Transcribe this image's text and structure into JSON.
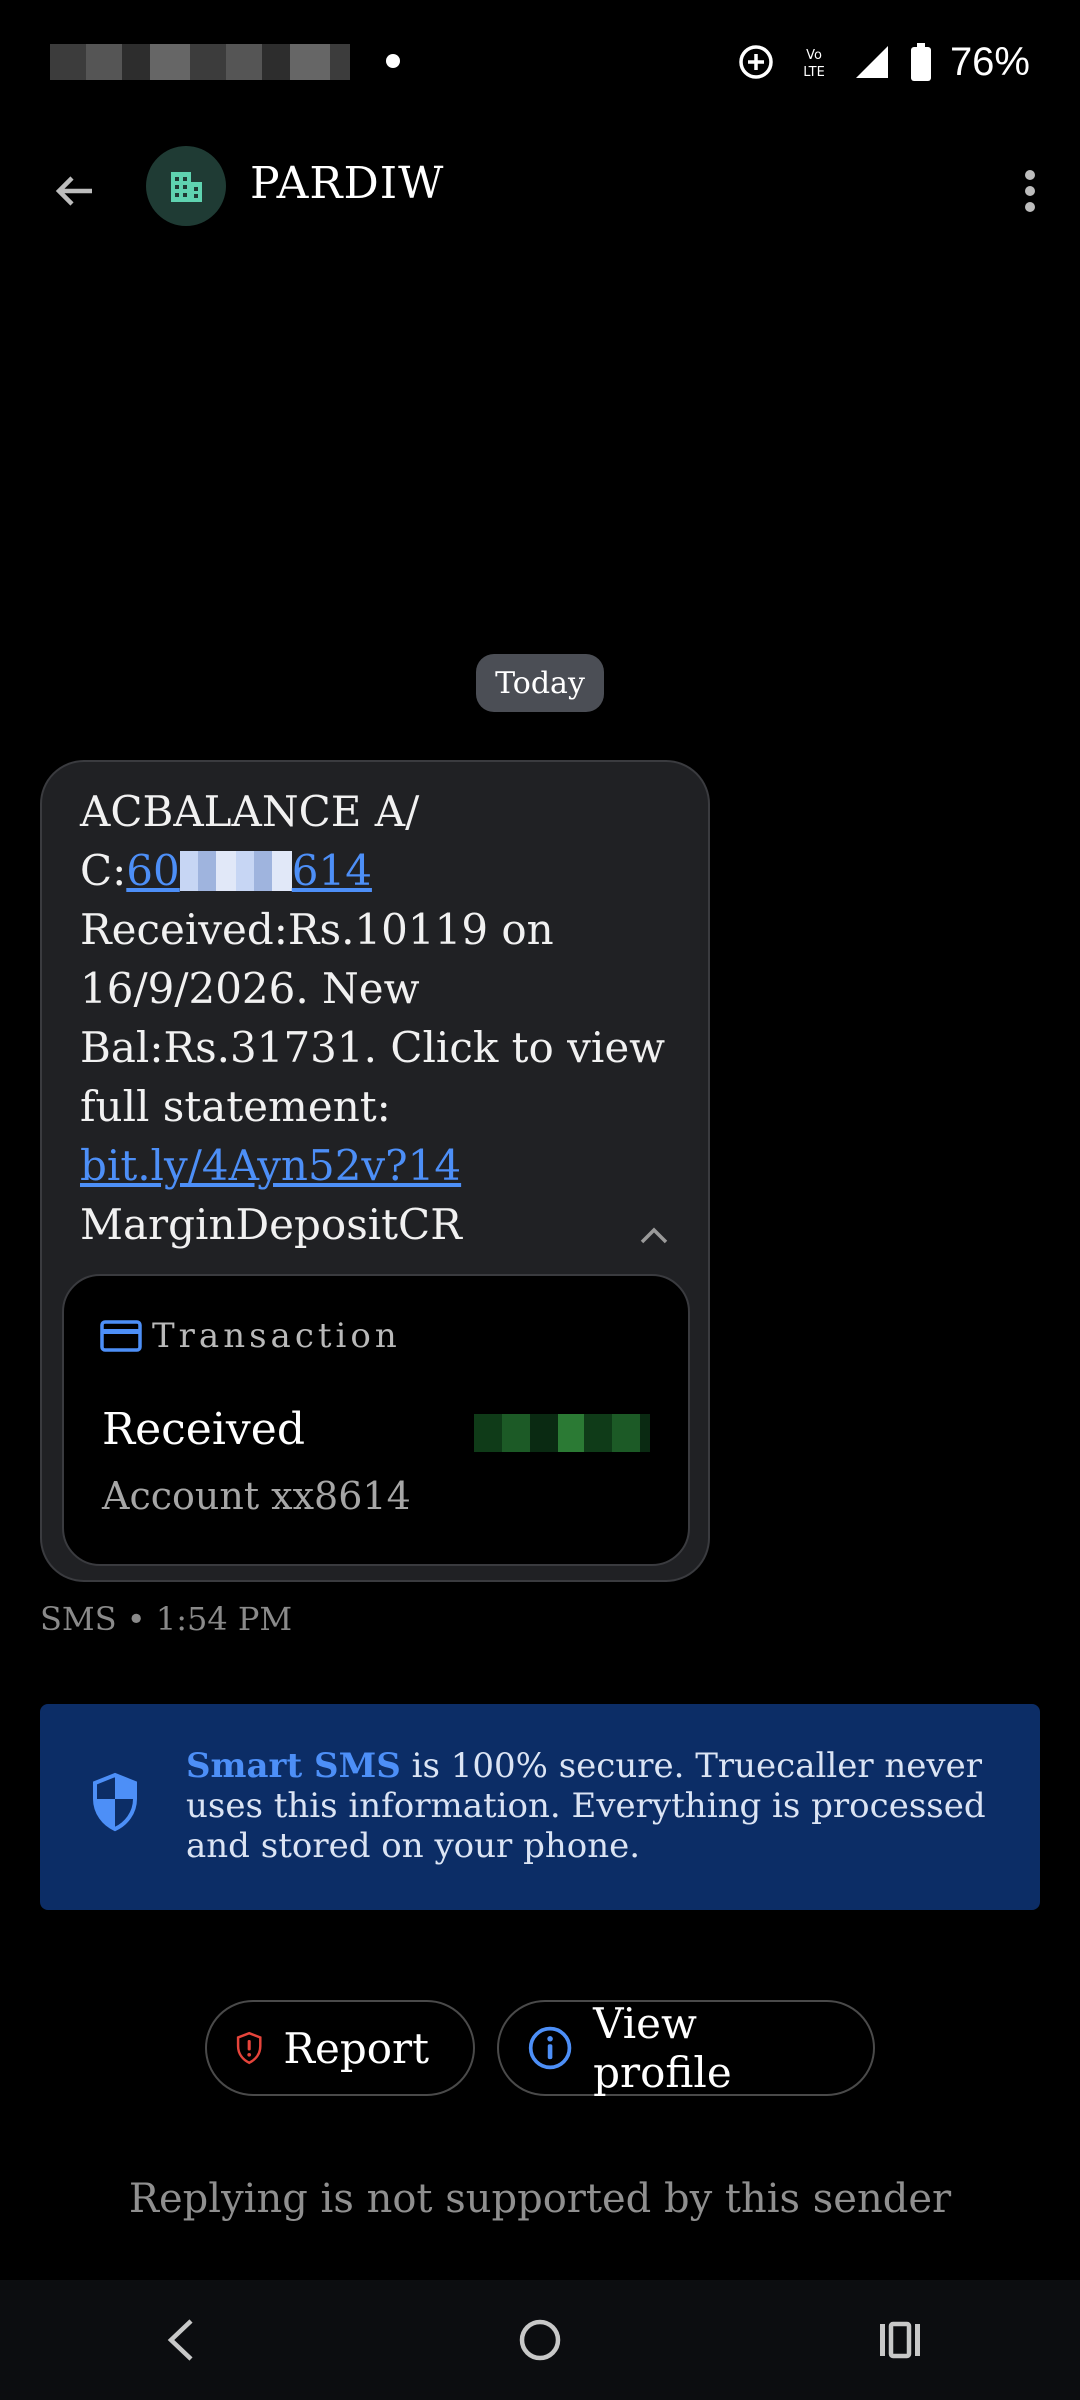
{
  "status_bar": {
    "battery_percent": "76%",
    "icons": [
      "data-saver-icon",
      "volte-icon",
      "signal-icon",
      "battery-icon"
    ]
  },
  "app_bar": {
    "sender_name": "PARDIW",
    "avatar_icon": "building-icon"
  },
  "conversation": {
    "date_chip": "Today",
    "message": {
      "line_1": "ACBALANCE A/",
      "account_prefix": "C:",
      "account_link_start": "60",
      "account_link_end": "614",
      "body_1": "Received:Rs.10119 on 16/9/2026. New Bal:Rs.31731. Click to view full statement: ",
      "link_text": "bit.ly/4Ayn52v?14",
      "footer_text": "MarginDepositCR"
    },
    "transaction_card": {
      "title": "Transaction",
      "status": "Received",
      "account": "Account xx8614"
    },
    "meta": "SMS • 1:54 PM"
  },
  "banner": {
    "highlight": "Smart SMS",
    "text": " is 100% secure. Truecaller never uses this information. Everything is processed and stored on your phone."
  },
  "actions": {
    "report_label": "Report",
    "view_profile_label": "View profile"
  },
  "reply_note": "Replying is not supported by this sender",
  "colors": {
    "accent": "#4d8ff7",
    "banner_bg": "#0c2d66",
    "bubble_bg": "#202124",
    "report_red": "#e5443b",
    "avatar_bg": "#1f3b34",
    "avatar_fg": "#5fd3b0"
  }
}
